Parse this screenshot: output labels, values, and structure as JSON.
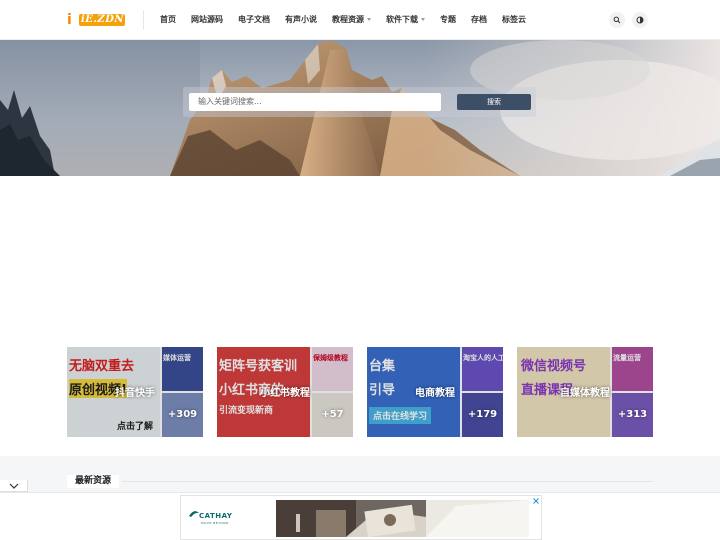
{
  "header": {
    "logo_text": "iE.ZDN",
    "nav": [
      {
        "label": "首页",
        "has_dropdown": false
      },
      {
        "label": "网站源码",
        "has_dropdown": false
      },
      {
        "label": "电子文档",
        "has_dropdown": false
      },
      {
        "label": "有声小说",
        "has_dropdown": false
      },
      {
        "label": "教程资源",
        "has_dropdown": true
      },
      {
        "label": "软件下载",
        "has_dropdown": true
      },
      {
        "label": "专题",
        "has_dropdown": false
      },
      {
        "label": "存档",
        "has_dropdown": false
      },
      {
        "label": "标签云",
        "has_dropdown": false
      }
    ],
    "icons": [
      "search-icon",
      "dark-mode-icon"
    ]
  },
  "hero": {
    "search_placeholder": "输入关键词搜索...",
    "search_button": "搜索"
  },
  "cards": [
    {
      "title": "抖音快手",
      "count": "+309",
      "main_text": [
        "无脑双重去",
        "原创视频!",
        "点击了解"
      ],
      "thumb_text": "媒体运营",
      "accent": "#2f3b8f"
    },
    {
      "title": "小红书教程",
      "count": "+57",
      "main_text": [
        "矩阵号获客训",
        "小红书商的",
        "引流变现新商"
      ],
      "thumb_text": "保姆级教程",
      "accent": "#d93a3a"
    },
    {
      "title": "电商教程",
      "count": "+179",
      "main_text": [
        "台集",
        "引导",
        "点击在线学习"
      ],
      "thumb_text": "淘宝人的人工",
      "accent": "#2f63c8"
    },
    {
      "title": "自媒体教程",
      "count": "+313",
      "main_text": [
        "微信视频号",
        "直播课程"
      ],
      "thumb_text": "流量运营",
      "accent": "#8b4fd6"
    }
  ],
  "latest": {
    "title": "最新资源"
  },
  "ad": {
    "brand": "CATHAY",
    "brand_sub": "MOVE BEYOND"
  },
  "colors": {
    "logo": "#f5a20a",
    "search_button": "#3d4f66"
  }
}
